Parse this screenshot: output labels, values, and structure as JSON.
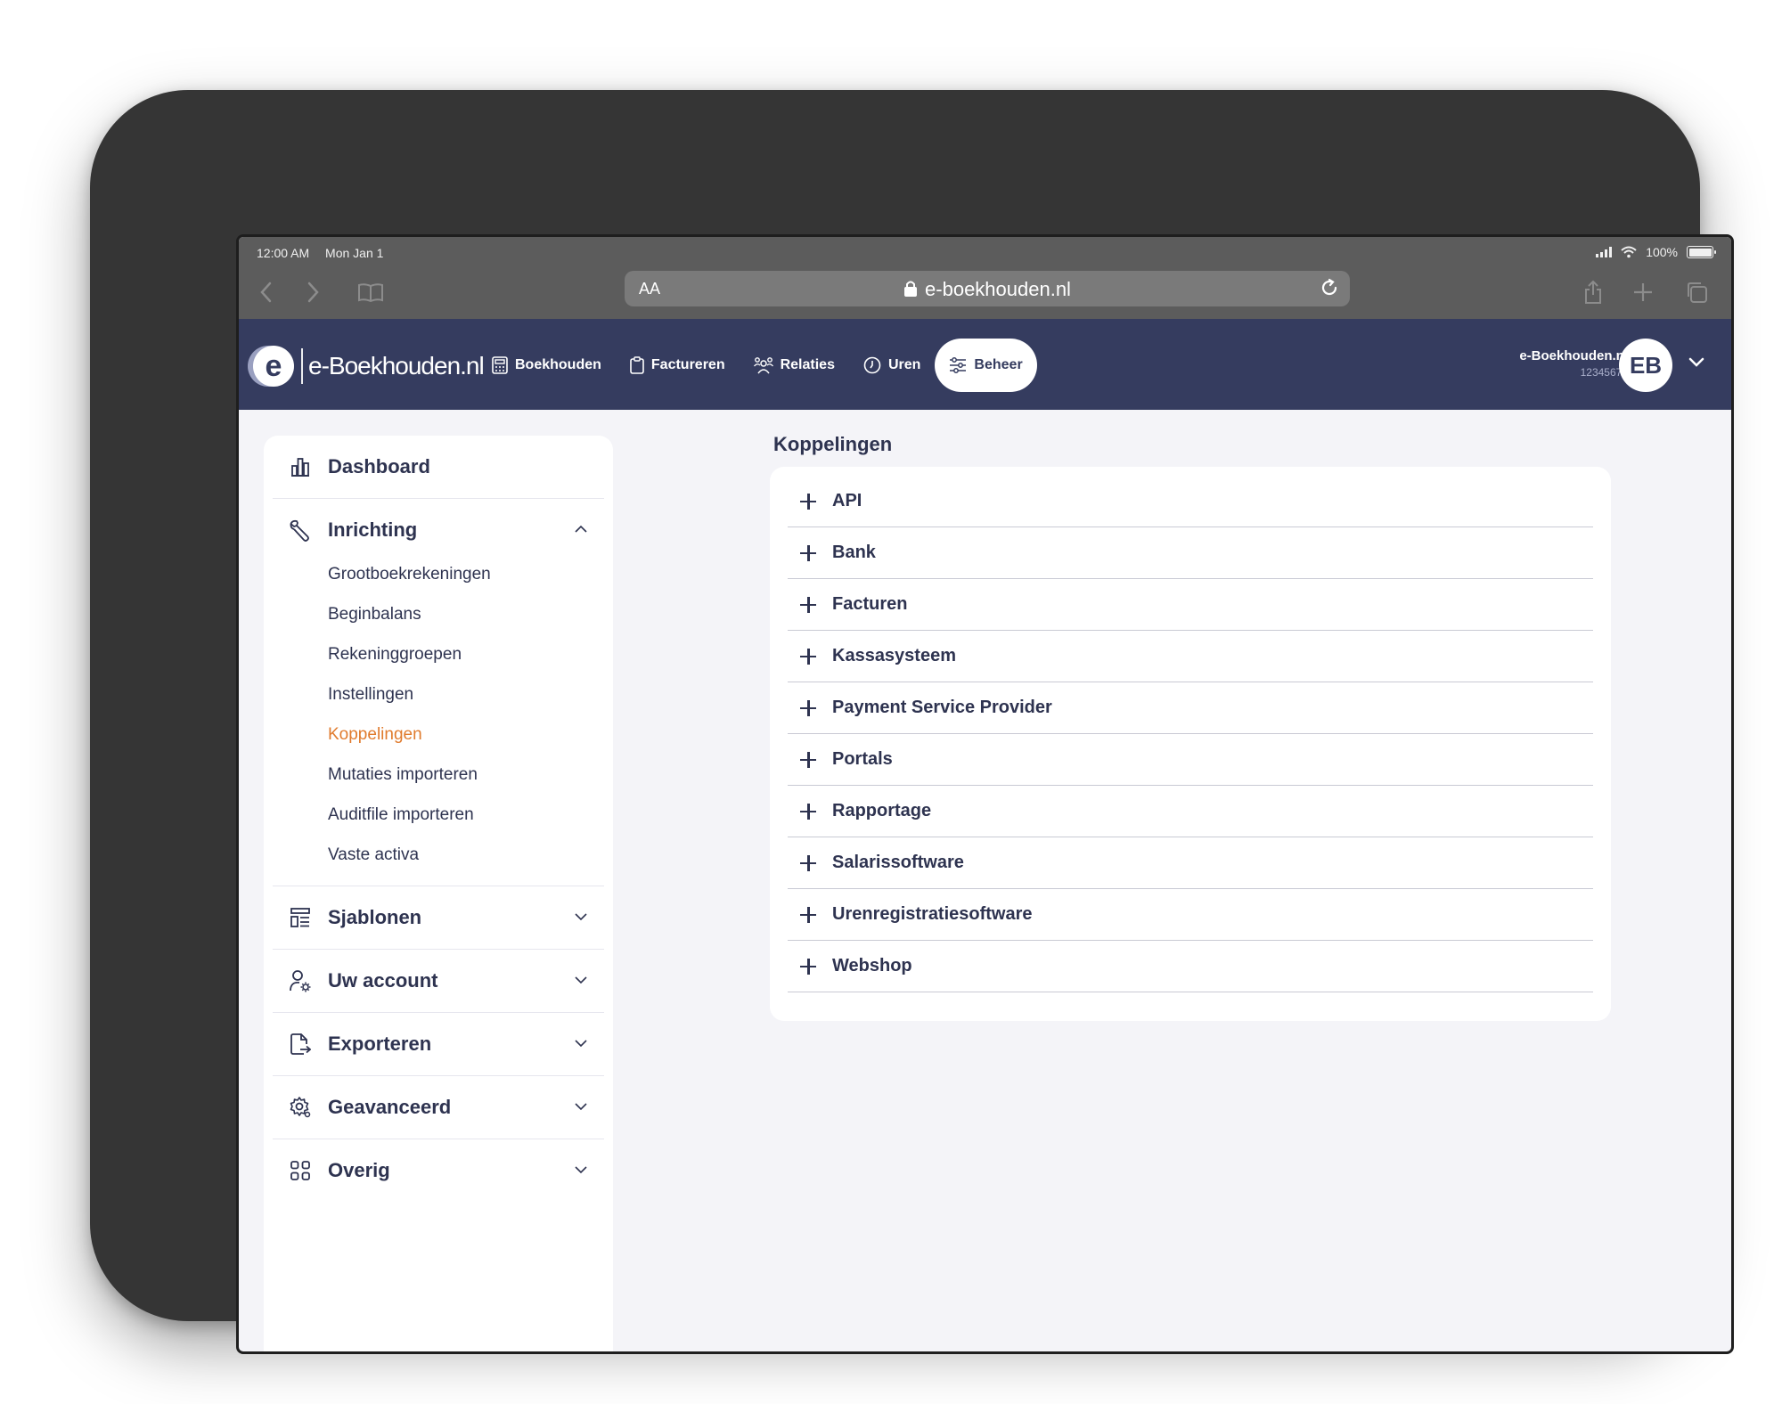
{
  "status_bar": {
    "time": "12:00 AM",
    "date": "Mon Jan 1",
    "battery": "100%",
    "battery_level": 1.0
  },
  "browser": {
    "text_size_label": "AA",
    "url": "e-boekhouden.nl",
    "icons": [
      "back-icon",
      "forward-icon",
      "bookmarks-icon",
      "lock-icon",
      "reload-icon",
      "share-icon",
      "new-tab-icon",
      "tabs-icon"
    ]
  },
  "header": {
    "logo_mark": "e",
    "logo_text": "e-Boekhouden.nl",
    "nav": [
      {
        "label": "Boekhouden",
        "icon": "calculator-icon"
      },
      {
        "label": "Factureren",
        "icon": "clipboard-icon"
      },
      {
        "label": "Relaties",
        "icon": "people-icon"
      },
      {
        "label": "Uren",
        "icon": "clock-icon"
      },
      {
        "label": "Beheer",
        "icon": "sliders-icon",
        "active": true
      }
    ],
    "account": {
      "company": "e-Boekhouden.nl",
      "number": "12345678",
      "initials": "EB"
    }
  },
  "sidebar": {
    "sections": [
      {
        "label": "Dashboard",
        "icon": "chart-icon"
      },
      {
        "label": "Inrichting",
        "icon": "wrench-icon",
        "expanded": true,
        "items": [
          {
            "label": "Grootboekrekeningen"
          },
          {
            "label": "Beginbalans"
          },
          {
            "label": "Rekeninggroepen"
          },
          {
            "label": "Instellingen"
          },
          {
            "label": "Koppelingen",
            "active": true
          },
          {
            "label": "Mutaties importeren"
          },
          {
            "label": "Auditfile importeren"
          },
          {
            "label": "Vaste activa"
          }
        ]
      },
      {
        "label": "Sjablonen",
        "icon": "template-icon"
      },
      {
        "label": "Uw account",
        "icon": "user-settings-icon"
      },
      {
        "label": "Exporteren",
        "icon": "export-icon"
      },
      {
        "label": "Geavanceerd",
        "icon": "gear-icon"
      },
      {
        "label": "Overig",
        "icon": "grid-icon"
      }
    ]
  },
  "main": {
    "title": "Koppelingen",
    "rows": [
      {
        "label": "API"
      },
      {
        "label": "Bank"
      },
      {
        "label": "Facturen"
      },
      {
        "label": "Kassasysteem"
      },
      {
        "label": "Payment Service Provider"
      },
      {
        "label": "Portals"
      },
      {
        "label": "Rapportage"
      },
      {
        "label": "Salarissoftware"
      },
      {
        "label": "Urenregistratiesoftware"
      },
      {
        "label": "Webshop"
      }
    ]
  },
  "colors": {
    "header_bg": "#353c5f",
    "text_primary": "#2e3350",
    "active_link": "#e07b2d",
    "page_bg": "#f4f4f8",
    "device_frame": "#353535"
  }
}
